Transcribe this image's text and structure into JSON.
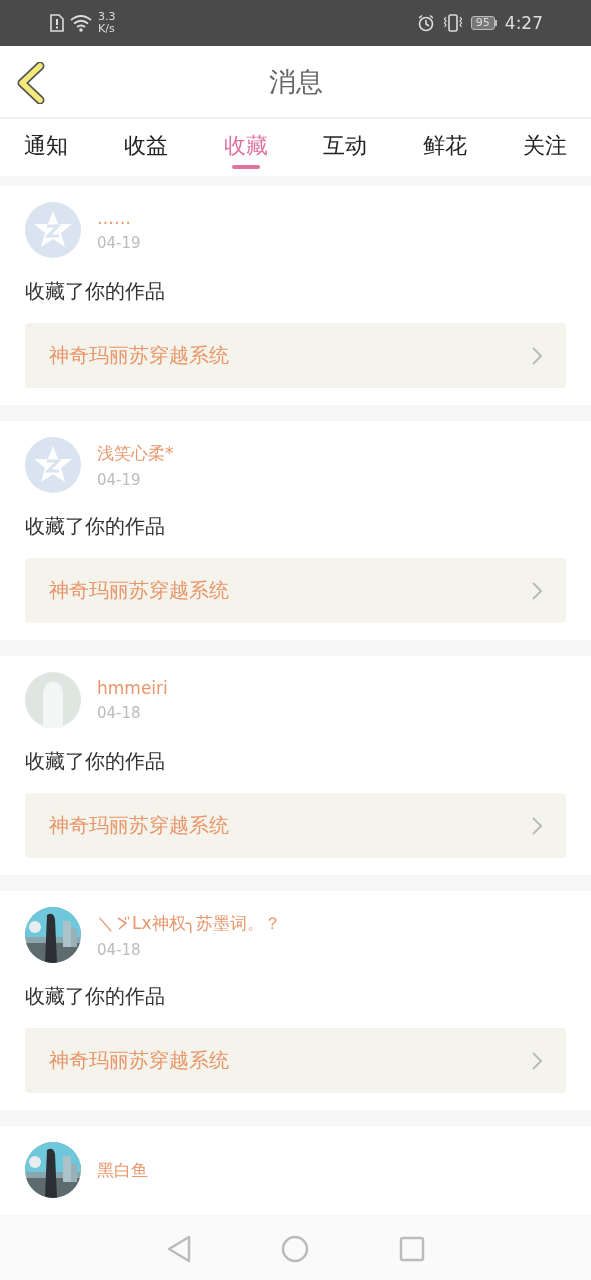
{
  "status_bar": {
    "speed": "3.3",
    "speed_unit": "K/s",
    "battery": "95",
    "time": "4:27"
  },
  "header": {
    "title": "消息"
  },
  "tabs": [
    {
      "label": "通知",
      "selected": false
    },
    {
      "label": "收益",
      "selected": false
    },
    {
      "label": "收藏",
      "selected": true
    },
    {
      "label": "互动",
      "selected": false
    },
    {
      "label": "鲜花",
      "selected": false
    },
    {
      "label": "关注",
      "selected": false
    }
  ],
  "messages": [
    {
      "kind": "default",
      "name": "……",
      "date": "04-19",
      "text": "收藏了你的作品",
      "work": "神奇玛丽苏穿越系统"
    },
    {
      "kind": "default",
      "name": "浅笑心柔*",
      "date": "04-19",
      "text": "收藏了你的作品",
      "work": "神奇玛丽苏穿越系统"
    },
    {
      "kind": "silhouette",
      "name": "hmmeiri",
      "date": "04-18",
      "text": "收藏了你的作品",
      "work": "神奇玛丽苏穿越系统"
    },
    {
      "kind": "picture",
      "name_prefix": "＼",
      "name": "Lx神权╮苏墨词。？",
      "date": "04-18",
      "text": "收藏了你的作品",
      "work": "神奇玛丽苏穿越系统"
    },
    {
      "kind": "picture",
      "name": "黑白鱼"
    }
  ]
}
